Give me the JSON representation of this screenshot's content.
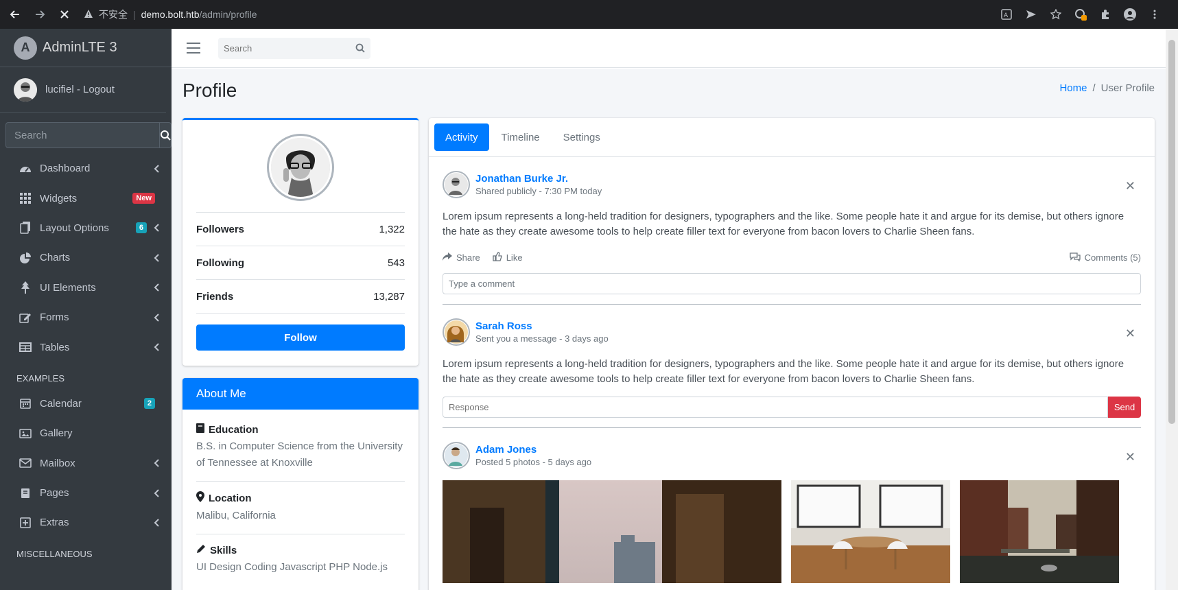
{
  "browser": {
    "insecure_label": "不安全",
    "url_host": "demo.bolt.htb",
    "url_path": "/admin/profile"
  },
  "sidebar": {
    "brand": "AdminLTE 3",
    "user": "lucifiel - Logout",
    "search_placeholder": "Search",
    "items": [
      {
        "label": "Dashboard",
        "icon": "dashboard-icon"
      },
      {
        "label": "Widgets",
        "icon": "widgets-icon",
        "badge": "New"
      },
      {
        "label": "Layout Options",
        "icon": "copy-icon",
        "badge": "6"
      },
      {
        "label": "Charts",
        "icon": "pie-chart-icon"
      },
      {
        "label": "UI Elements",
        "icon": "tree-icon"
      },
      {
        "label": "Forms",
        "icon": "edit-icon"
      },
      {
        "label": "Tables",
        "icon": "table-icon"
      }
    ],
    "header_examples": "EXAMPLES",
    "examples": [
      {
        "label": "Calendar",
        "icon": "calendar-icon",
        "badge": "2"
      },
      {
        "label": "Gallery",
        "icon": "image-icon"
      },
      {
        "label": "Mailbox",
        "icon": "envelope-icon"
      },
      {
        "label": "Pages",
        "icon": "book-icon"
      },
      {
        "label": "Extras",
        "icon": "plus-square-icon"
      }
    ],
    "header_misc": "MISCELLANEOUS"
  },
  "topbar": {
    "search_placeholder": "Search"
  },
  "page": {
    "title": "Profile",
    "breadcrumb_home": "Home",
    "breadcrumb_sep": "/",
    "breadcrumb_current": "User Profile"
  },
  "profile": {
    "stats": [
      {
        "label": "Followers",
        "value": "1,322"
      },
      {
        "label": "Following",
        "value": "543"
      },
      {
        "label": "Friends",
        "value": "13,287"
      }
    ],
    "follow_label": "Follow"
  },
  "about": {
    "title": "About Me",
    "education_title": "Education",
    "education_text": "B.S. in Computer Science from the University of Tennessee at Knoxville",
    "location_title": "Location",
    "location_text": "Malibu, California",
    "skills_title": "Skills",
    "skills_text": "UI Design Coding Javascript PHP Node.js"
  },
  "tabs": [
    "Activity",
    "Timeline",
    "Settings"
  ],
  "posts": [
    {
      "name": "Jonathan Burke Jr.",
      "desc": "Shared publicly - 7:30 PM today",
      "text": "Lorem ipsum represents a long-held tradition for designers, typographers and the like. Some people hate it and argue for its demise, but others ignore the hate as they create awesome tools to help create filler text for everyone from bacon lovers to Charlie Sheen fans.",
      "share": "Share",
      "like": "Like",
      "comments": "Comments (5)",
      "comment_placeholder": "Type a comment"
    },
    {
      "name": "Sarah Ross",
      "desc": "Sent you a message - 3 days ago",
      "text": "Lorem ipsum represents a long-held tradition for designers, typographers and the like. Some people hate it and argue for its demise, but others ignore the hate as they create awesome tools to help create filler text for everyone from bacon lovers to Charlie Sheen fans.",
      "response_placeholder": "Response",
      "send": "Send"
    },
    {
      "name": "Adam Jones",
      "desc": "Posted 5 photos - 5 days ago"
    }
  ],
  "colors": {
    "primary": "#007bff",
    "danger": "#dc3545",
    "sidebar": "#343a40",
    "info": "#17a2b8"
  }
}
